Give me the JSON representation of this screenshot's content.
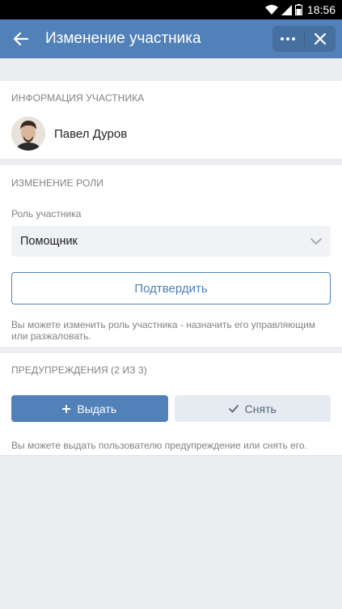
{
  "status_bar": {
    "time": "18:56"
  },
  "header": {
    "title": "Изменение участника"
  },
  "member_info": {
    "section_title": "ИНФОРМАЦИЯ УЧАСТНИКА",
    "name": "Павел Дуров"
  },
  "role": {
    "section_title": "ИЗМЕНЕНИЕ РОЛИ",
    "field_label": "Роль участника",
    "selected_value": "Помощник",
    "confirm_label": "Подтвердить",
    "hint": "Вы можете изменить роль участника - назначить его управляющим или разжаловать."
  },
  "warnings": {
    "section_title": "ПРЕДУПРЕЖДЕНИЯ (2 ИЗ 3)",
    "give_label": "Выдать",
    "remove_label": "Снять",
    "hint": "Вы можете выдать пользователю предупреждение или снять его."
  },
  "colors": {
    "header": "#5181b8",
    "accent": "#5181b8",
    "background": "#ebedf0"
  }
}
